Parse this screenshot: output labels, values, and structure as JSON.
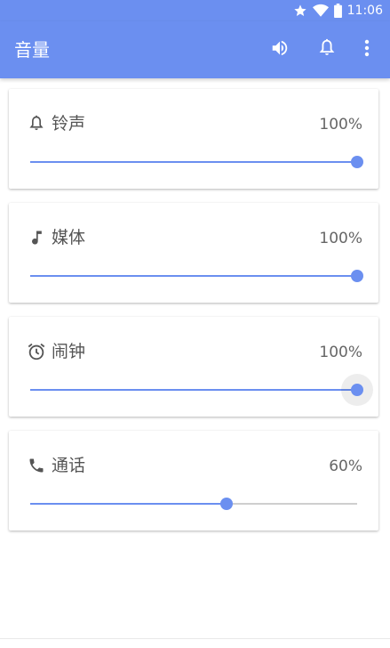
{
  "status_bar": {
    "time": "11:06",
    "icons": [
      "star-icon",
      "wifi-icon",
      "battery-icon"
    ]
  },
  "app_bar": {
    "title": "音量",
    "actions": [
      "speaker-icon",
      "bell-icon",
      "more-vert-icon"
    ]
  },
  "colors": {
    "accent": "#6b8ff0",
    "text": "#555555",
    "track": "#cfcfcf"
  },
  "volumes": [
    {
      "label": "铃声",
      "percent_text": "100%",
      "level": 1.0,
      "icon": "bell-icon"
    },
    {
      "label": "媒体",
      "percent_text": "100%",
      "level": 1.0,
      "icon": "music-note-icon"
    },
    {
      "label": "闹钟",
      "percent_text": "100%",
      "level": 1.0,
      "icon": "alarm-clock-icon",
      "focused": true
    },
    {
      "label": "通话",
      "percent_text": "60%",
      "level": 0.6,
      "icon": "phone-icon"
    }
  ]
}
